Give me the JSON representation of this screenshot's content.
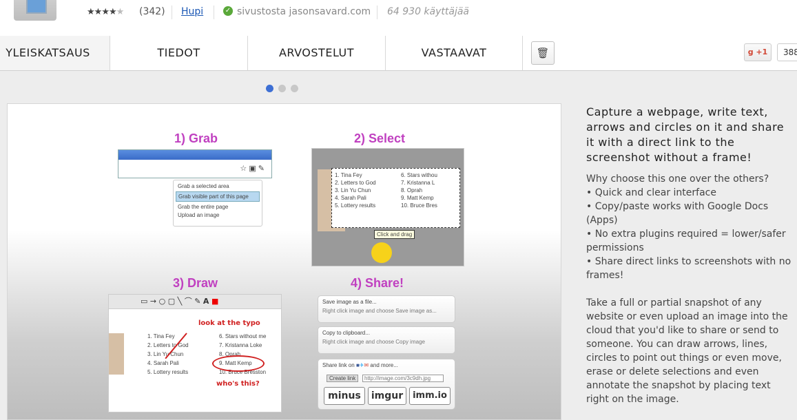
{
  "header": {
    "rating_count": "(342)",
    "rating_value": 4,
    "rating_max": 5,
    "category_link": "Hupi",
    "source_text": "sivustosta jasonsavard.com",
    "users_text": "64 930 käyttäjää"
  },
  "tabs": [
    {
      "label": "YLEISKATSAUS",
      "active": true
    },
    {
      "label": "TIEDOT",
      "active": false
    },
    {
      "label": "ARVOSTELUT",
      "active": false
    },
    {
      "label": "VASTAAVAT",
      "active": false
    }
  ],
  "gplus": {
    "label": "+1",
    "count": "388"
  },
  "carousel": {
    "total": 3,
    "active_index": 0
  },
  "screenshot": {
    "steps": [
      "1) Grab",
      "2) Select",
      "3) Draw",
      "4) Share!"
    ],
    "grab_menu": [
      "Grab a selected area",
      "Grab visible part of this page",
      "Grab the entire page",
      "Upload an image"
    ],
    "select_tooltip": "Click and drag",
    "select_list_left": [
      "1. Tina Fey",
      "2. Letters to God",
      "3. Lin Yu Chun",
      "4. Sarah Pali",
      "5. Lottery results"
    ],
    "select_list_right": [
      "6. Stars withou",
      "7. Kristanna L",
      "8. Oprah",
      "9. Matt Kemp",
      "10. Bruce Bres"
    ],
    "draw_annotation_1": "look at the typo",
    "draw_annotation_2": "who's this?",
    "draw_list_left": [
      "1. Tina Fey",
      "2. Letters to God",
      "3. Lin Yu Chun",
      "4. Sarah Pali",
      "5. Lottery results"
    ],
    "draw_list_right": [
      "6. Stars without me",
      "7. Kristanna Loke",
      "8. Oprah",
      "9. Matt Kemp",
      "10. Bruce Bresston"
    ],
    "share_box_1_title": "Save image as a file...",
    "share_box_1_sub": "Right click image and choose Save image as...",
    "share_box_2_title": "Copy to clipboard...",
    "share_box_2_sub": "Right click image and choose Copy image",
    "share_box_3_title": "Share link on",
    "share_box_3_more": "and more...",
    "share_button": "Create link",
    "share_url": "http://image.com/3c9dh.jpg",
    "share_logos": [
      "minus",
      "imgur",
      "imm.io"
    ]
  },
  "description": {
    "headline": "Capture a webpage, write text, arrows and circles on it and share it with a direct link to the screenshot without a frame!",
    "why_title": "Why choose this one over the others?",
    "bullets": [
      "• Quick and clear interface",
      "• Copy/paste works with Google Docs (Apps)",
      "• No extra plugins required = lower/safer permissions",
      "• Share direct links to screenshots with no frames!"
    ],
    "body": "Take a full or partial snapshot of any website or even upload an image into the cloud that you'd like to share or send to someone. You can draw arrows, lines, circles to point out things or even move, erase or delete selections and even annotate the snapshot by placing text right on the image."
  }
}
